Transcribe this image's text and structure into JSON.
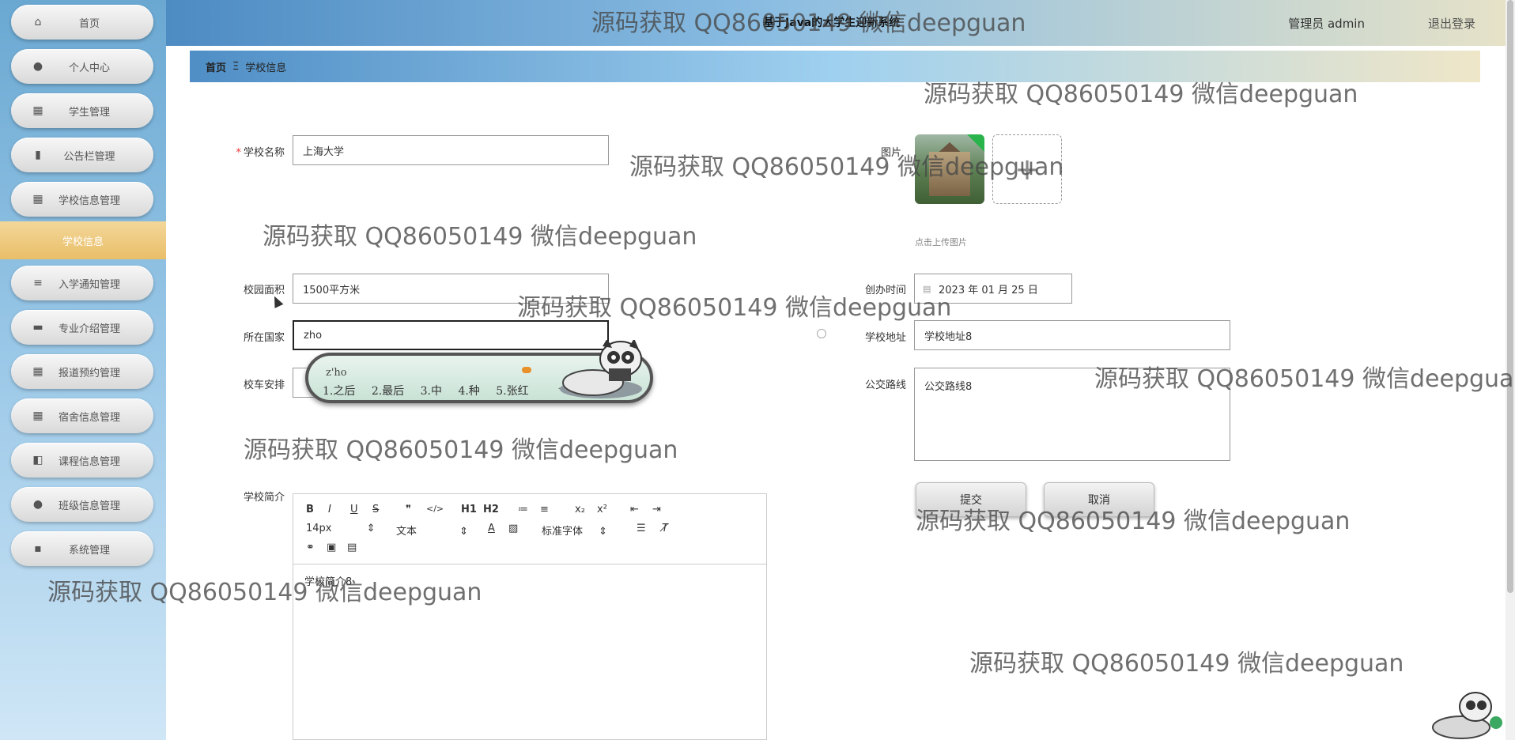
{
  "sidebar": {
    "items": [
      {
        "label": "首页",
        "icon": "home-icon"
      },
      {
        "label": "个人中心",
        "icon": "user-icon"
      },
      {
        "label": "学生管理",
        "icon": "grid-icon"
      },
      {
        "label": "公告栏管理",
        "icon": "chart-icon"
      },
      {
        "label": "学校信息管理",
        "icon": "grid-icon"
      },
      {
        "label": "入学通知管理",
        "icon": "list-icon"
      },
      {
        "label": "专业介绍管理",
        "icon": "briefcase-icon"
      },
      {
        "label": "报道预约管理",
        "icon": "grid-icon"
      },
      {
        "label": "宿舍信息管理",
        "icon": "grid-icon"
      },
      {
        "label": "课程信息管理",
        "icon": "wallet-icon"
      },
      {
        "label": "班级信息管理",
        "icon": "lightbulb-icon"
      },
      {
        "label": "系统管理",
        "icon": "chat-icon"
      }
    ],
    "active_sub": "学校信息"
  },
  "header": {
    "title": "基于Java的大学生迎新系统",
    "admin": "管理员 admin",
    "logout": "退出登录"
  },
  "breadcrumb": {
    "home": "首页",
    "sep": "Ξ",
    "current": "学校信息"
  },
  "form": {
    "school_name_label": "学校名称",
    "school_name_value": "上海大学",
    "image_label": "图片",
    "upload_hint": "点击上传图片",
    "upload_plus": "+",
    "area_label": "校园面积",
    "area_value": "1500平方米",
    "founded_label": "创办时间",
    "founded_value": "2023 年 01 月 25 日",
    "country_label": "所在国家",
    "country_value": "zho",
    "address_label": "学校地址",
    "address_value": "学校地址8",
    "bus_label": "校车安排",
    "route_label": "公交路线",
    "route_value": "公交路线8",
    "intro_label": "学校简介",
    "intro_value": "学校简介8",
    "submit": "提交",
    "cancel": "取消"
  },
  "editor": {
    "font_size": "14px",
    "paragraph": "文本",
    "font_family": "标准字体",
    "buttons": [
      "B",
      "I",
      "U",
      "S",
      "❞",
      "</>",
      "H1",
      "H2",
      "≔",
      "≡",
      "x₂",
      "x²",
      "⇤",
      "⇥"
    ]
  },
  "ime": {
    "composition": "z'ho",
    "candidates": [
      "1.之后",
      "2.最后",
      "3.中",
      "4.种",
      "5.张红"
    ]
  },
  "watermark": "源码获取 QQ86050149 微信deepguan"
}
